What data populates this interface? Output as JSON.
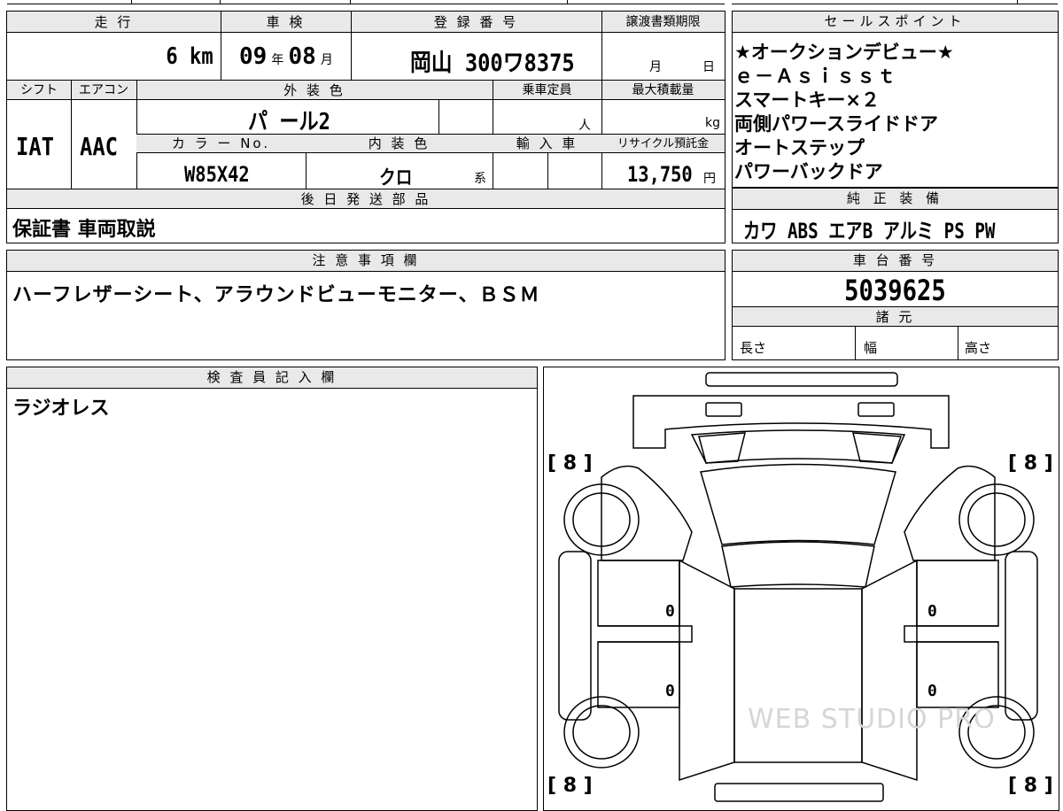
{
  "main": {
    "headers": {
      "mileage": "走 行",
      "inspection": "車 検",
      "registration": "登 録 番 号",
      "deadline": "譲渡書類期限",
      "shift": "シフト",
      "aircon": "エアコン",
      "exterior": "外 装 色",
      "capacity": "乗車定員",
      "max_load": "最大積載量",
      "color_no": "カ ラ ー No.",
      "interior": "内 装 色",
      "import": "輸 入 車",
      "recycle": "リサイクル預託金",
      "later_parts": "後 日 発 送 部 品"
    },
    "mileage_value": "6",
    "mileage_unit": "km",
    "inspection_year": "09",
    "year_unit": "年",
    "inspection_month": "08",
    "month_unit": "月",
    "registration_value": "岡山 300ワ8375",
    "deadline_month_unit": "月",
    "deadline_day_unit": "日",
    "shift_value": "IAT",
    "aircon_value": "AAC",
    "exterior_value": "パ ール2",
    "capacity_unit": "人",
    "load_unit": "kg",
    "color_no_value": "W85X42",
    "interior_value": "クロ",
    "interior_suffix": "系",
    "recycle_value": "13,750",
    "recycle_unit": "円",
    "later_parts_value": "保証書 車両取説"
  },
  "sales": {
    "header": "セールスポイント",
    "points": [
      "★オークションデビュー★",
      "ｅ－Ａｓｉｓｓｔ",
      "スマートキー×２",
      "両側パワースライドドア",
      "オートステップ",
      "パワーバックドア"
    ]
  },
  "equipment": {
    "header": "純 正 装 備",
    "value": "カワ ABS エアB アルミ PS PW"
  },
  "notes": {
    "header": "注 意 事 項 欄",
    "value": "ハーフレザーシート、アラウンドビューモニター、ＢＳＭ"
  },
  "chassis": {
    "header": "車 台 番 号",
    "value": "5039625",
    "spec_header": "諸 元",
    "length_label": "長さ",
    "width_label": "幅",
    "height_label": "高さ"
  },
  "inspector": {
    "header": "検 査 員 記 入 欄",
    "value": "ラジオレス"
  },
  "diagram": {
    "tire_tl": "[ 8 ]",
    "tire_tr": "[ 8 ]",
    "tire_bl": "[ 8 ]",
    "tire_br": "[ 8 ]",
    "left_front": "0",
    "left_rear": "0",
    "right_front": "0",
    "right_rear": "0",
    "watermark": "WEB STUDIO PRO"
  }
}
